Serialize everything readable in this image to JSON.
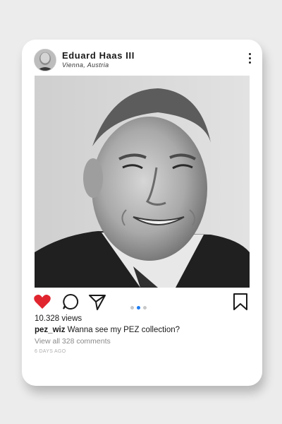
{
  "post": {
    "user_name": "Eduard Haas III",
    "location": "Vienna, Austria",
    "avatar_icon": "portrait-avatar",
    "more_icon": "more-vertical-icon",
    "photo_description_icon": "portrait-photo",
    "liked": true,
    "like_color": "#e0252f",
    "carousel": {
      "count": 3,
      "active_index": 1,
      "active_color": "#1d7cf2",
      "inactive_color": "#c8c8c8"
    },
    "views": "10.328 views",
    "caption_user": "pez_wiz",
    "caption_text": "Wanna see my PEZ collection?",
    "comments_link": "View all 328 comments",
    "timestamp": "6 DAYS AGO"
  }
}
